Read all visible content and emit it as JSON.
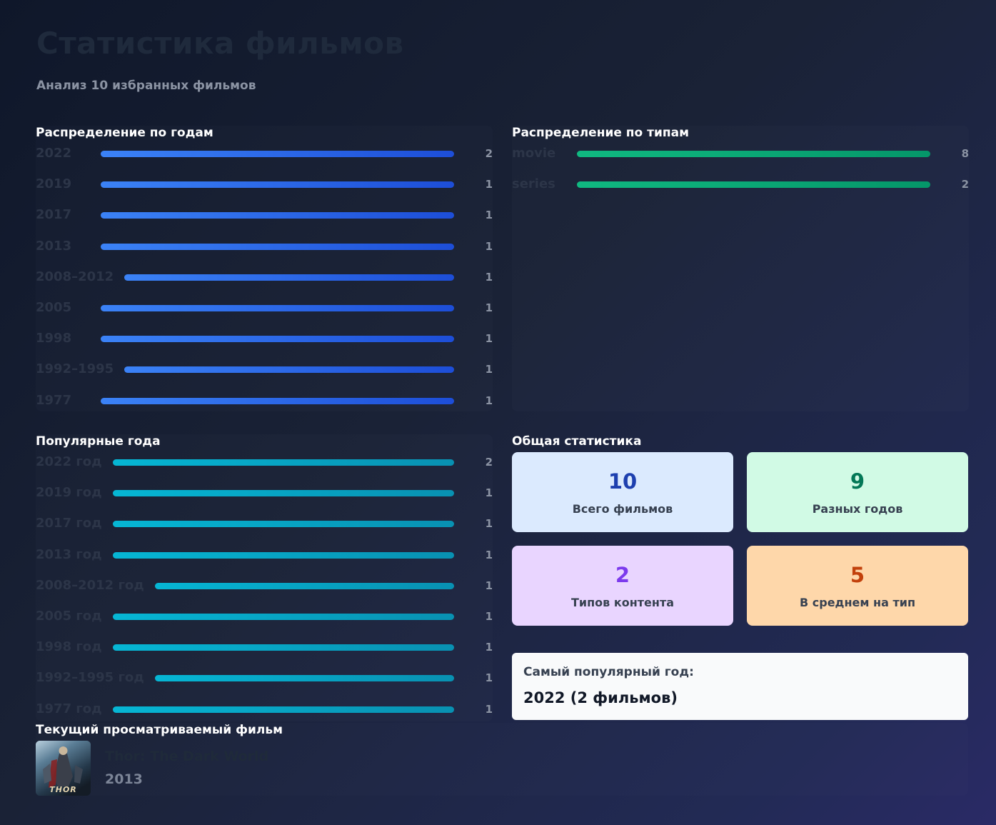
{
  "header": {
    "title": "Статистика фильмов",
    "subtitle": "Анализ 10 избранных фильмов"
  },
  "years_panel": {
    "title": "Распределение по годам",
    "max": 2,
    "rows": [
      {
        "label": "2022",
        "value": 2
      },
      {
        "label": "2019",
        "value": 1
      },
      {
        "label": "2017",
        "value": 1
      },
      {
        "label": "2013",
        "value": 1
      },
      {
        "label": "2008–2012",
        "value": 1
      },
      {
        "label": "2005",
        "value": 1
      },
      {
        "label": "1998",
        "value": 1
      },
      {
        "label": "1992–1995",
        "value": 1
      },
      {
        "label": "1977",
        "value": 1
      }
    ]
  },
  "types_panel": {
    "title": "Распределение по типам",
    "max": 8,
    "rows": [
      {
        "label": "movie",
        "value": 8
      },
      {
        "label": "series",
        "value": 2
      }
    ]
  },
  "popular_years_panel": {
    "title": "Популярные года",
    "max": 2,
    "rows": [
      {
        "label": "2022 год",
        "value": 2
      },
      {
        "label": "2019 год",
        "value": 1
      },
      {
        "label": "2017 год",
        "value": 1
      },
      {
        "label": "2013 год",
        "value": 1
      },
      {
        "label": "2008–2012 год",
        "value": 1
      },
      {
        "label": "2005 год",
        "value": 1
      },
      {
        "label": "1998 год",
        "value": 1
      },
      {
        "label": "1992–1995 год",
        "value": 1
      },
      {
        "label": "1977 год",
        "value": 1
      }
    ]
  },
  "general_stats": {
    "title": "Общая статистика",
    "cards": [
      {
        "value": "10",
        "label": "Всего фильмов",
        "bg": "#dbeafe",
        "color": "#1e40af"
      },
      {
        "value": "9",
        "label": "Разных годов",
        "bg": "#d1fae5",
        "color": "#047857"
      },
      {
        "value": "2",
        "label": "Типов контента",
        "bg": "#e9d5ff",
        "color": "#7c3aed"
      },
      {
        "value": "5",
        "label": "В среднем на тип",
        "bg": "#fed7aa",
        "color": "#c2410c"
      }
    ],
    "popular_year_label": "Самый популярный год:",
    "popular_year_value": "2022 (2 фильмов)"
  },
  "current_movie": {
    "title": "Текущий просматриваемый фильм",
    "movie_title": "Thor: The Dark World",
    "poster_text": "THOR",
    "year": "2013"
  }
}
